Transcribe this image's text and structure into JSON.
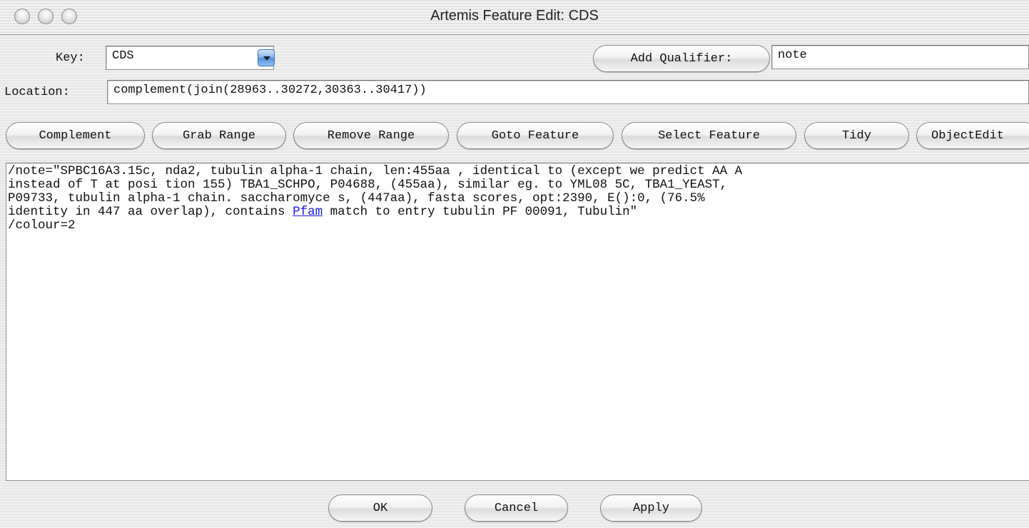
{
  "window": {
    "title": "Artemis Feature Edit: CDS"
  },
  "key": {
    "label": "Key:",
    "value": "CDS"
  },
  "qualifier": {
    "button_label": "Add Qualifier:",
    "value": "note"
  },
  "location": {
    "label": "Location:",
    "value": "complement(join(28963..30272,30363..30417))"
  },
  "toolbar": {
    "complement": "Complement",
    "grab_range": "Grab Range",
    "remove_range": "Remove Range",
    "goto_feature": "Goto Feature",
    "select_feature": "Select Feature",
    "tidy": "Tidy",
    "object_edit": "ObjectEdit"
  },
  "editor": {
    "line1": "/note=\"SPBC16A3.15c, nda2, tubulin alpha-1 chain, len:455aa , identical to (except we predict AA A",
    "line2": "instead of T at posi tion 155) TBA1_SCHPO, P04688, (455aa), similar eg. to YML08 5C, TBA1_YEAST,",
    "line3": "P09733, tubulin alpha-1 chain. saccharomyce s, (447aa), fasta scores, opt:2390, E():0, (76.5%",
    "line4_before_link": "identity in 447 aa overlap), contains ",
    "line4_link": "Pfam",
    "line4_after_link": " match to entry tubulin PF 00091, Tubulin\"",
    "line5": "/colour=2"
  },
  "footer": {
    "ok": "OK",
    "cancel": "Cancel",
    "apply": "Apply"
  }
}
